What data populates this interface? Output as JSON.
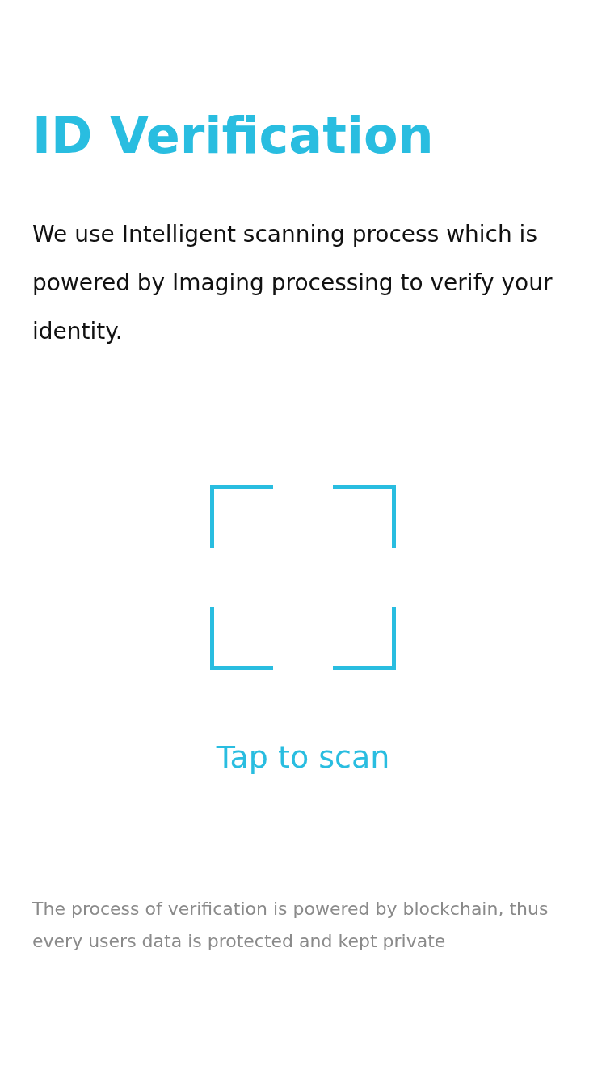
{
  "title": "ID Verification",
  "description": "We use Intelligent scanning process which is powered by Imaging processing to verify your identity.",
  "scan": {
    "label": "Tap to scan"
  },
  "footer_note": "The process of verification is powered by blockchain, thus every users data is protected and kept private"
}
